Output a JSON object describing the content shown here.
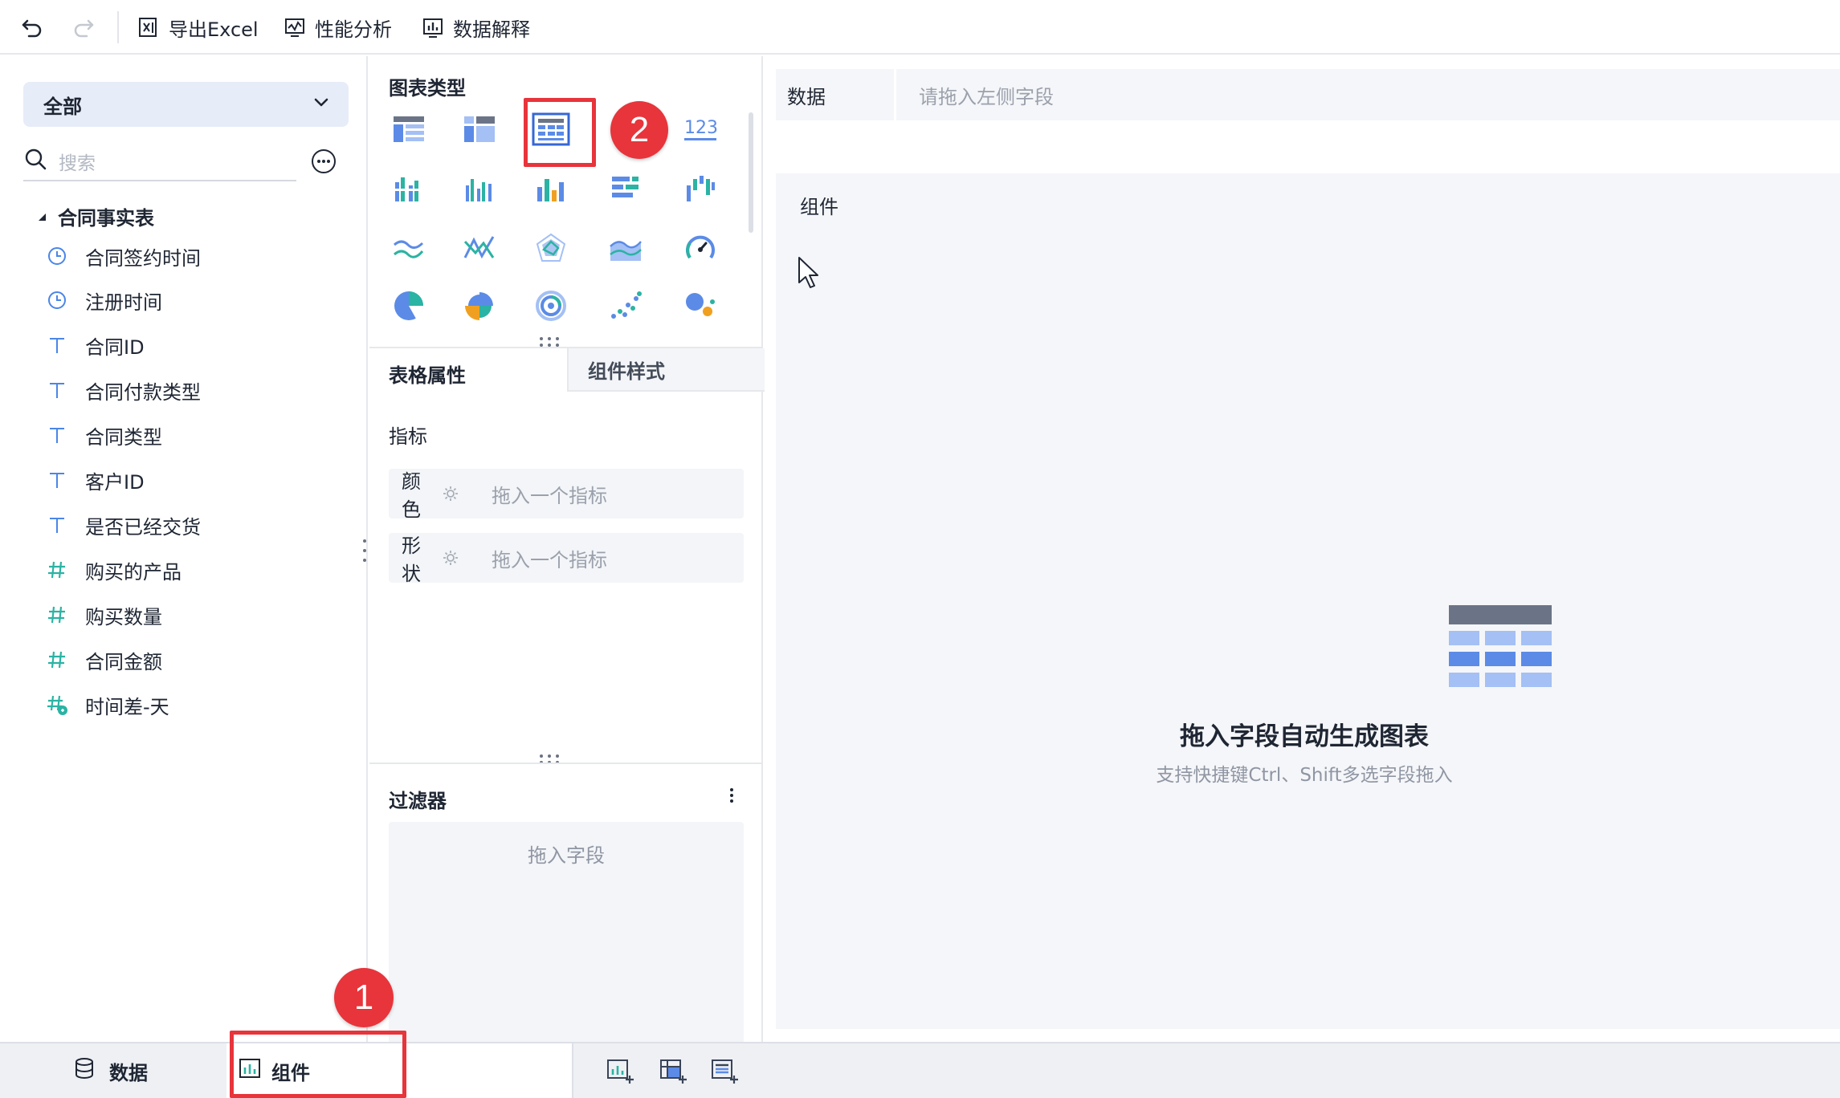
{
  "toolbar": {
    "undo_icon": "undo-icon",
    "redo_icon": "redo-icon",
    "export_excel": "导出Excel",
    "performance": "性能分析",
    "data_explain": "数据解释"
  },
  "left": {
    "scope": "全部",
    "search_placeholder": "搜索",
    "table_name": "合同事实表",
    "fields": [
      {
        "label": "合同签约时间",
        "type": "time"
      },
      {
        "label": "注册时间",
        "type": "time"
      },
      {
        "label": "合同ID",
        "type": "text"
      },
      {
        "label": "合同付款类型",
        "type": "text"
      },
      {
        "label": "合同类型",
        "type": "text"
      },
      {
        "label": "客户ID",
        "type": "text"
      },
      {
        "label": "是否已经交货",
        "type": "text"
      },
      {
        "label": "购买的产品",
        "type": "number"
      },
      {
        "label": "购买数量",
        "type": "number"
      },
      {
        "label": "合同金额",
        "type": "number"
      },
      {
        "label": "时间差-天",
        "type": "calc-number"
      }
    ]
  },
  "middle": {
    "chart_type_title": "图表类型",
    "chart_types": [
      "group-table-icon",
      "cross-table-icon",
      "detail-table-icon",
      "kpi-123-icon",
      "grouped-bar-icon",
      "multi-bar-icon",
      "color-bar-icon",
      "horizontal-bar-icon",
      "waterfall-bar-icon",
      "line-icon",
      "scatter-line-icon",
      "radar-icon",
      "area-icon",
      "gauge-icon",
      "pie-icon",
      "rose-pie-icon",
      "multi-ring-icon",
      "scatter-icon",
      "bubble-icon"
    ],
    "selected_chart": "detail-table-icon",
    "callout_2": "2",
    "tab_table_props": "表格属性",
    "tab_comp_style": "组件样式",
    "metrics_label": "指标",
    "color_label": "颜色",
    "shape_label": "形状",
    "drop_metric_hint": "拖入一个指标",
    "filter_title": "过滤器",
    "filter_drop_hint": "拖入字段"
  },
  "right": {
    "data_label": "数据",
    "data_hint": "请拖入左侧字段",
    "component_label": "组件",
    "empty_title": "拖入字段自动生成图表",
    "empty_sub": "支持快捷键Ctrl、Shift多选字段拖入"
  },
  "bottom": {
    "tab_data": "数据",
    "tab_component": "组件",
    "callout_1": "1",
    "add_icons": [
      "add-chart-icon",
      "add-cross-table-icon",
      "add-detail-table-icon"
    ]
  },
  "colors": {
    "accent_red": "#e8343b",
    "icon_blue": "#4a86e8",
    "icon_teal": "#2bb3a3",
    "table_dark": "#6b7487",
    "table_light": "#a4c0f4",
    "table_mid": "#5b8be6"
  }
}
